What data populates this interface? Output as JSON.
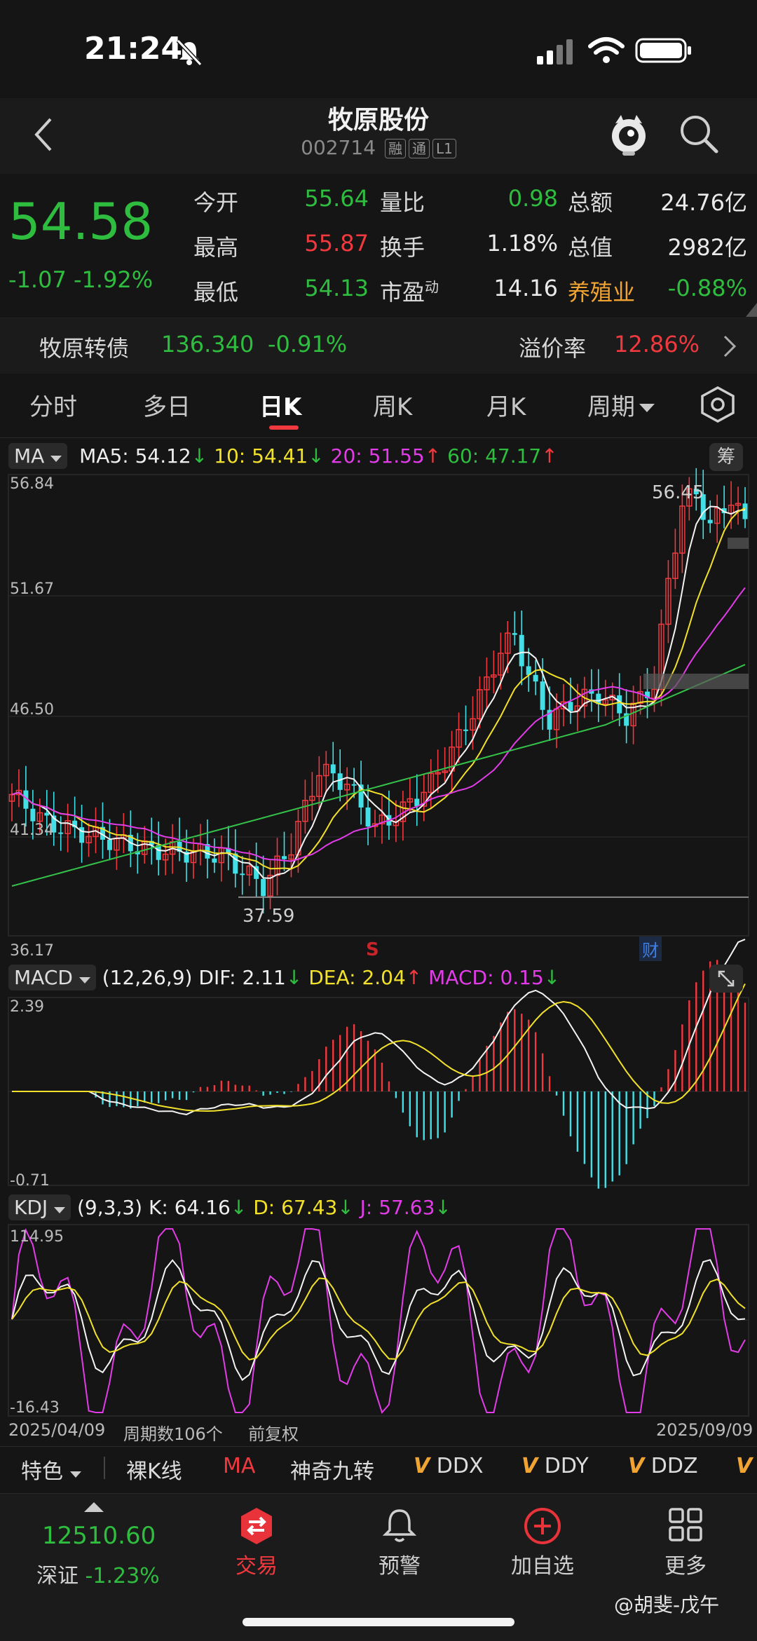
{
  "status_bar": {
    "time": "21:24"
  },
  "header": {
    "title": "牧原股份",
    "code": "002714",
    "tags": [
      "融",
      "通",
      "L1"
    ]
  },
  "quote": {
    "price": "54.58",
    "change": "-1.07",
    "change_pct": "-1.92%",
    "rows": [
      [
        {
          "label": "今开",
          "value": "55.64",
          "color": "green"
        },
        {
          "label": "量比",
          "value": "0.98",
          "color": "green"
        },
        {
          "label": "总额",
          "value": "24.76亿",
          "color": "white"
        }
      ],
      [
        {
          "label": "最高",
          "value": "55.87",
          "color": "red"
        },
        {
          "label": "换手",
          "value": "1.18%",
          "color": "white"
        },
        {
          "label": "总值",
          "value": "2982亿",
          "color": "white"
        }
      ],
      [
        {
          "label": "最低",
          "value": "54.13",
          "color": "green"
        },
        {
          "label": "市盈",
          "label_sup": "动",
          "value": "14.16",
          "color": "white"
        },
        {
          "label": "养殖业",
          "value": "-0.88%",
          "color": "green",
          "label_color": "orange"
        }
      ]
    ]
  },
  "bond": {
    "name": "牧原转债",
    "price": "136.340",
    "change_pct": "-0.91%",
    "premium_label": "溢价率",
    "premium_value": "12.86%"
  },
  "tabs": [
    "分时",
    "多日",
    "日K",
    "周K",
    "月K",
    "周期"
  ],
  "active_tab": "日K",
  "ma_bar": {
    "selector": "MA",
    "ma5": "MA5: 54.12",
    "ma10": "10: 54.41",
    "ma20": "20: 51.55",
    "ma60": "60: 47.17",
    "chip_button": "筹"
  },
  "price_chart": {
    "y_labels": [
      "56.84",
      "51.67",
      "46.50",
      "41.34",
      "36.17"
    ],
    "high_label": "56.45",
    "low_label": "37.59",
    "marker_s": "S",
    "marker_cai": "财"
  },
  "macd_bar": {
    "selector": "MACD",
    "params": "(12,26,9)",
    "dif": "DIF: 2.11",
    "dea": "DEA: 2.04",
    "macd": "MACD: 0.15",
    "y_labels": [
      "2.39",
      "-0.71"
    ]
  },
  "kdj_bar": {
    "selector": "KDJ",
    "params": "(9,3,3)",
    "k": "K: 64.16",
    "d": "D: 67.43",
    "j": "J: 57.63",
    "y_labels": [
      "114.95",
      "-16.43"
    ]
  },
  "footer_axis": {
    "start_date": "2025/04/09",
    "period_count": "周期数106个",
    "adjust": "前复权",
    "end_date": "2025/09/09"
  },
  "indicator_bar": {
    "feature": "特色",
    "items": [
      "裸K线",
      "MA",
      "神奇九转"
    ],
    "v_items": [
      "DDX",
      "DDY",
      "DDZ"
    ]
  },
  "index": {
    "value": "12510.60",
    "name": "深证",
    "change_pct": "-1.23%"
  },
  "nav": [
    {
      "label": "交易",
      "icon": "trade-icon"
    },
    {
      "label": "预警",
      "icon": "bell-icon"
    },
    {
      "label": "加自选",
      "icon": "plus-circle-icon"
    },
    {
      "label": "更多",
      "icon": "grid-icon"
    }
  ],
  "watermark": "@胡斐-戊午"
}
